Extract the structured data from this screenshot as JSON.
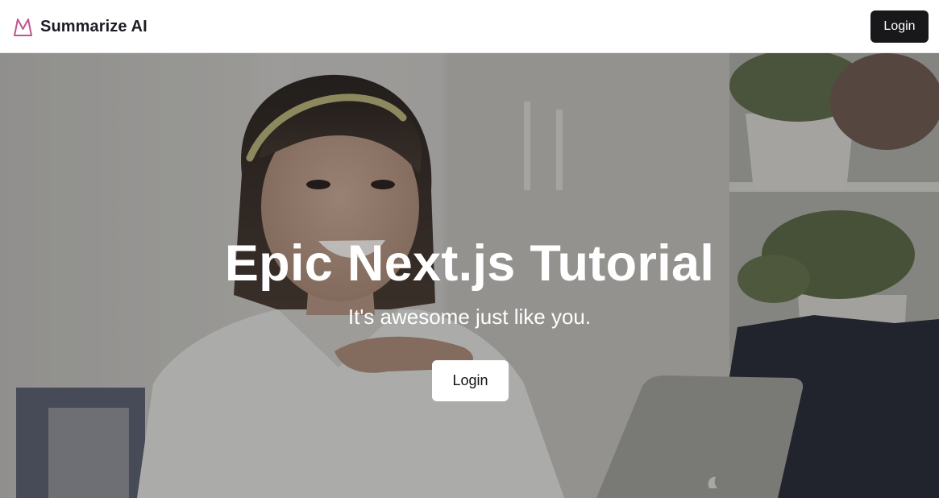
{
  "header": {
    "brand_name": "Summarize AI",
    "brand_icon": "mountain-logo-icon",
    "login_label": "Login"
  },
  "hero": {
    "title": "Epic Next.js Tutorial",
    "subtitle": "It's awesome just like you.",
    "cta_label": "Login",
    "background_image": "smiling-woman-with-laptop-photo"
  },
  "colors": {
    "brand_accent": "#c0568e",
    "header_button_bg": "#18181b",
    "hero_button_bg": "#ffffff",
    "hero_text": "#ffffff"
  }
}
